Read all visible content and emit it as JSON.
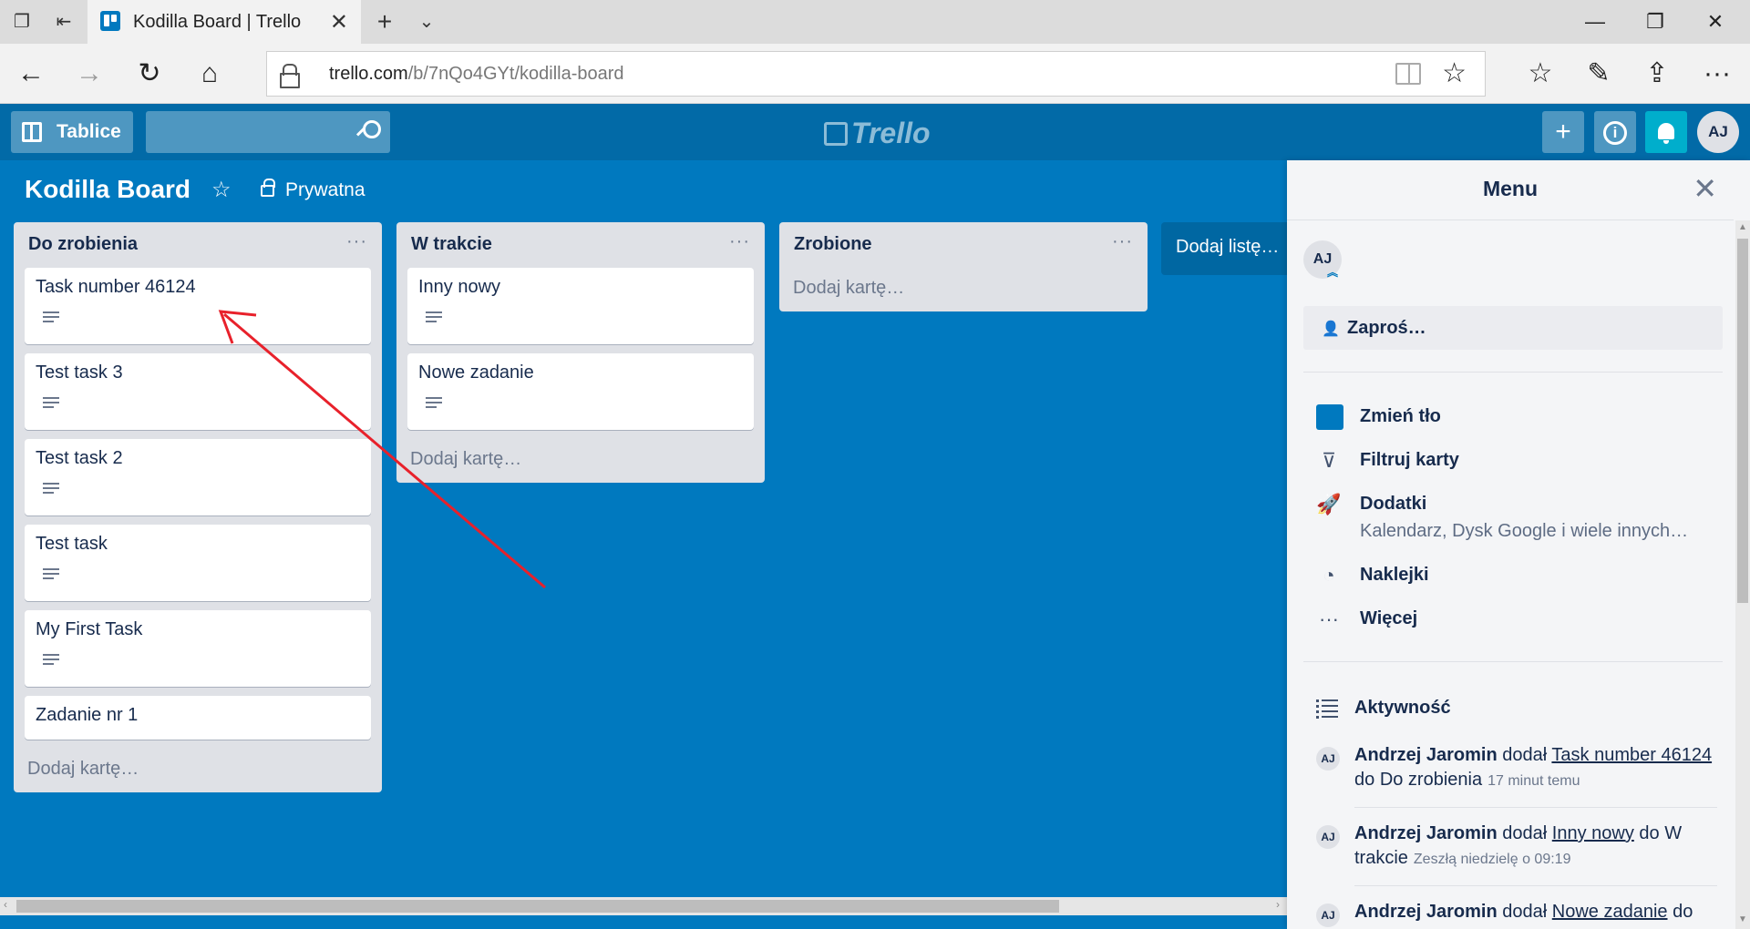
{
  "browser": {
    "tab_title": "Kodilla Board | Trello",
    "url_host": "trello.com",
    "url_path": "/b/7nQo4GYt/kodilla-board"
  },
  "header": {
    "boards_label": "Tablice",
    "logo_text": "Trello",
    "avatar_initials": "AJ"
  },
  "board": {
    "title": "Kodilla Board",
    "privacy": "Prywatna"
  },
  "lists": [
    {
      "title": "Do zrobienia",
      "menu": "···",
      "cards": [
        "Task number 46124",
        "Test task 3",
        "Test task 2",
        "Test task",
        "My First Task",
        "Zadanie nr 1"
      ],
      "add_card": "Dodaj kartę…"
    },
    {
      "title": "W trakcie",
      "menu": "···",
      "cards": [
        "Inny nowy",
        "Nowe zadanie"
      ],
      "add_card": "Dodaj kartę…"
    },
    {
      "title": "Zrobione",
      "menu": "···",
      "cards": [],
      "add_card": "Dodaj kartę…"
    }
  ],
  "add_list": "Dodaj listę…",
  "menu": {
    "title": "Menu",
    "avatar": "AJ",
    "invite": "Zaproś…",
    "items": {
      "background": "Zmień tło",
      "filter": "Filtruj karty",
      "powerups": "Dodatki",
      "powerups_sub": "Kalendarz, Dysk Google i wiele innych…",
      "stickers": "Naklejki",
      "more": "Więcej"
    },
    "activity_title": "Aktywność",
    "activity": [
      {
        "user": "Andrzej Jaromin",
        "verb": "dodał",
        "card": "Task number 46124",
        "prep": "do",
        "list": "Do zrobienia",
        "time": "17 minut temu"
      },
      {
        "user": "Andrzej Jaromin",
        "verb": "dodał",
        "card": "Inny nowy",
        "prep": "do",
        "list": "W trakcie",
        "time": "Zeszłą niedzielę o 09:19"
      },
      {
        "user": "Andrzej Jaromin",
        "verb": "dodał",
        "card": "Nowe zadanie",
        "prep": "do",
        "list": "",
        "time": ""
      }
    ]
  },
  "colors": {
    "board_bg": "#0079bf",
    "header_bg": "#026aa7",
    "list_bg": "#dfe1e6",
    "annotation_arrow": "#e8212b"
  }
}
